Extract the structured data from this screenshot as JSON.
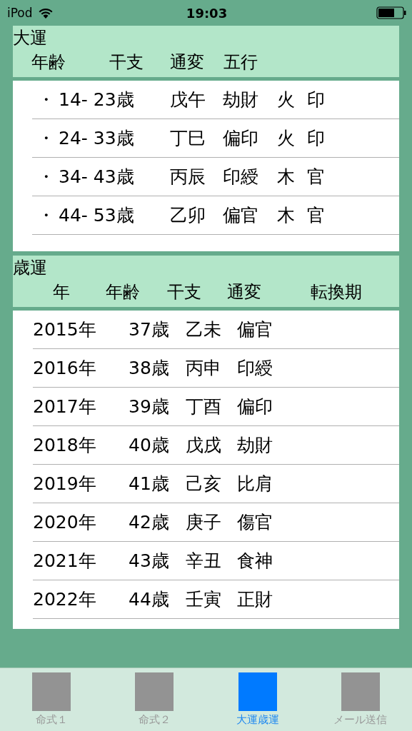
{
  "status_bar": {
    "device": "iPod",
    "time": "19:03"
  },
  "daiun": {
    "title": "大運",
    "columns": [
      "年齢",
      "干支",
      "通変",
      "五行"
    ],
    "rows": [
      {
        "bullet": "・",
        "age": "14- 23歳",
        "kanshi": "戊午",
        "tsuhen": "劫財",
        "gogyo": "火",
        "column_5": "印"
      },
      {
        "bullet": "・",
        "age": "24- 33歳",
        "kanshi": "丁巳",
        "tsuhen": "偏印",
        "gogyo": "火",
        "column_5": "印"
      },
      {
        "bullet": "・",
        "age": "34- 43歳",
        "kanshi": "丙辰",
        "tsuhen": "印綬",
        "gogyo": "木",
        "column_5": "官"
      },
      {
        "bullet": "・",
        "age": "44- 53歳",
        "kanshi": "乙卯",
        "tsuhen": "偏官",
        "gogyo": "木",
        "column_5": "官"
      }
    ]
  },
  "saiun": {
    "title": "歳運",
    "columns": [
      "年",
      "年齢",
      "干支",
      "通変",
      "転換期"
    ],
    "rows": [
      {
        "year": "2015年",
        "age": "37歳",
        "kanshi": "乙未",
        "tsuhen": "偏官"
      },
      {
        "year": "2016年",
        "age": "38歳",
        "kanshi": "丙申",
        "tsuhen": "印綬"
      },
      {
        "year": "2017年",
        "age": "39歳",
        "kanshi": "丁酉",
        "tsuhen": "偏印"
      },
      {
        "year": "2018年",
        "age": "40歳",
        "kanshi": "戊戌",
        "tsuhen": "劫財"
      },
      {
        "year": "2019年",
        "age": "41歳",
        "kanshi": "己亥",
        "tsuhen": "比肩"
      },
      {
        "year": "2020年",
        "age": "42歳",
        "kanshi": "庚子",
        "tsuhen": "傷官"
      },
      {
        "year": "2021年",
        "age": "43歳",
        "kanshi": "辛丑",
        "tsuhen": "食神"
      },
      {
        "year": "2022年",
        "age": "44歳",
        "kanshi": "壬寅",
        "tsuhen": "正財"
      }
    ]
  },
  "tab_bar": [
    {
      "label": "命式１",
      "selected": false
    },
    {
      "label": "命式２",
      "selected": false
    },
    {
      "label": "大運歳運",
      "selected": true
    },
    {
      "label": "メール送信",
      "selected": false
    }
  ]
}
